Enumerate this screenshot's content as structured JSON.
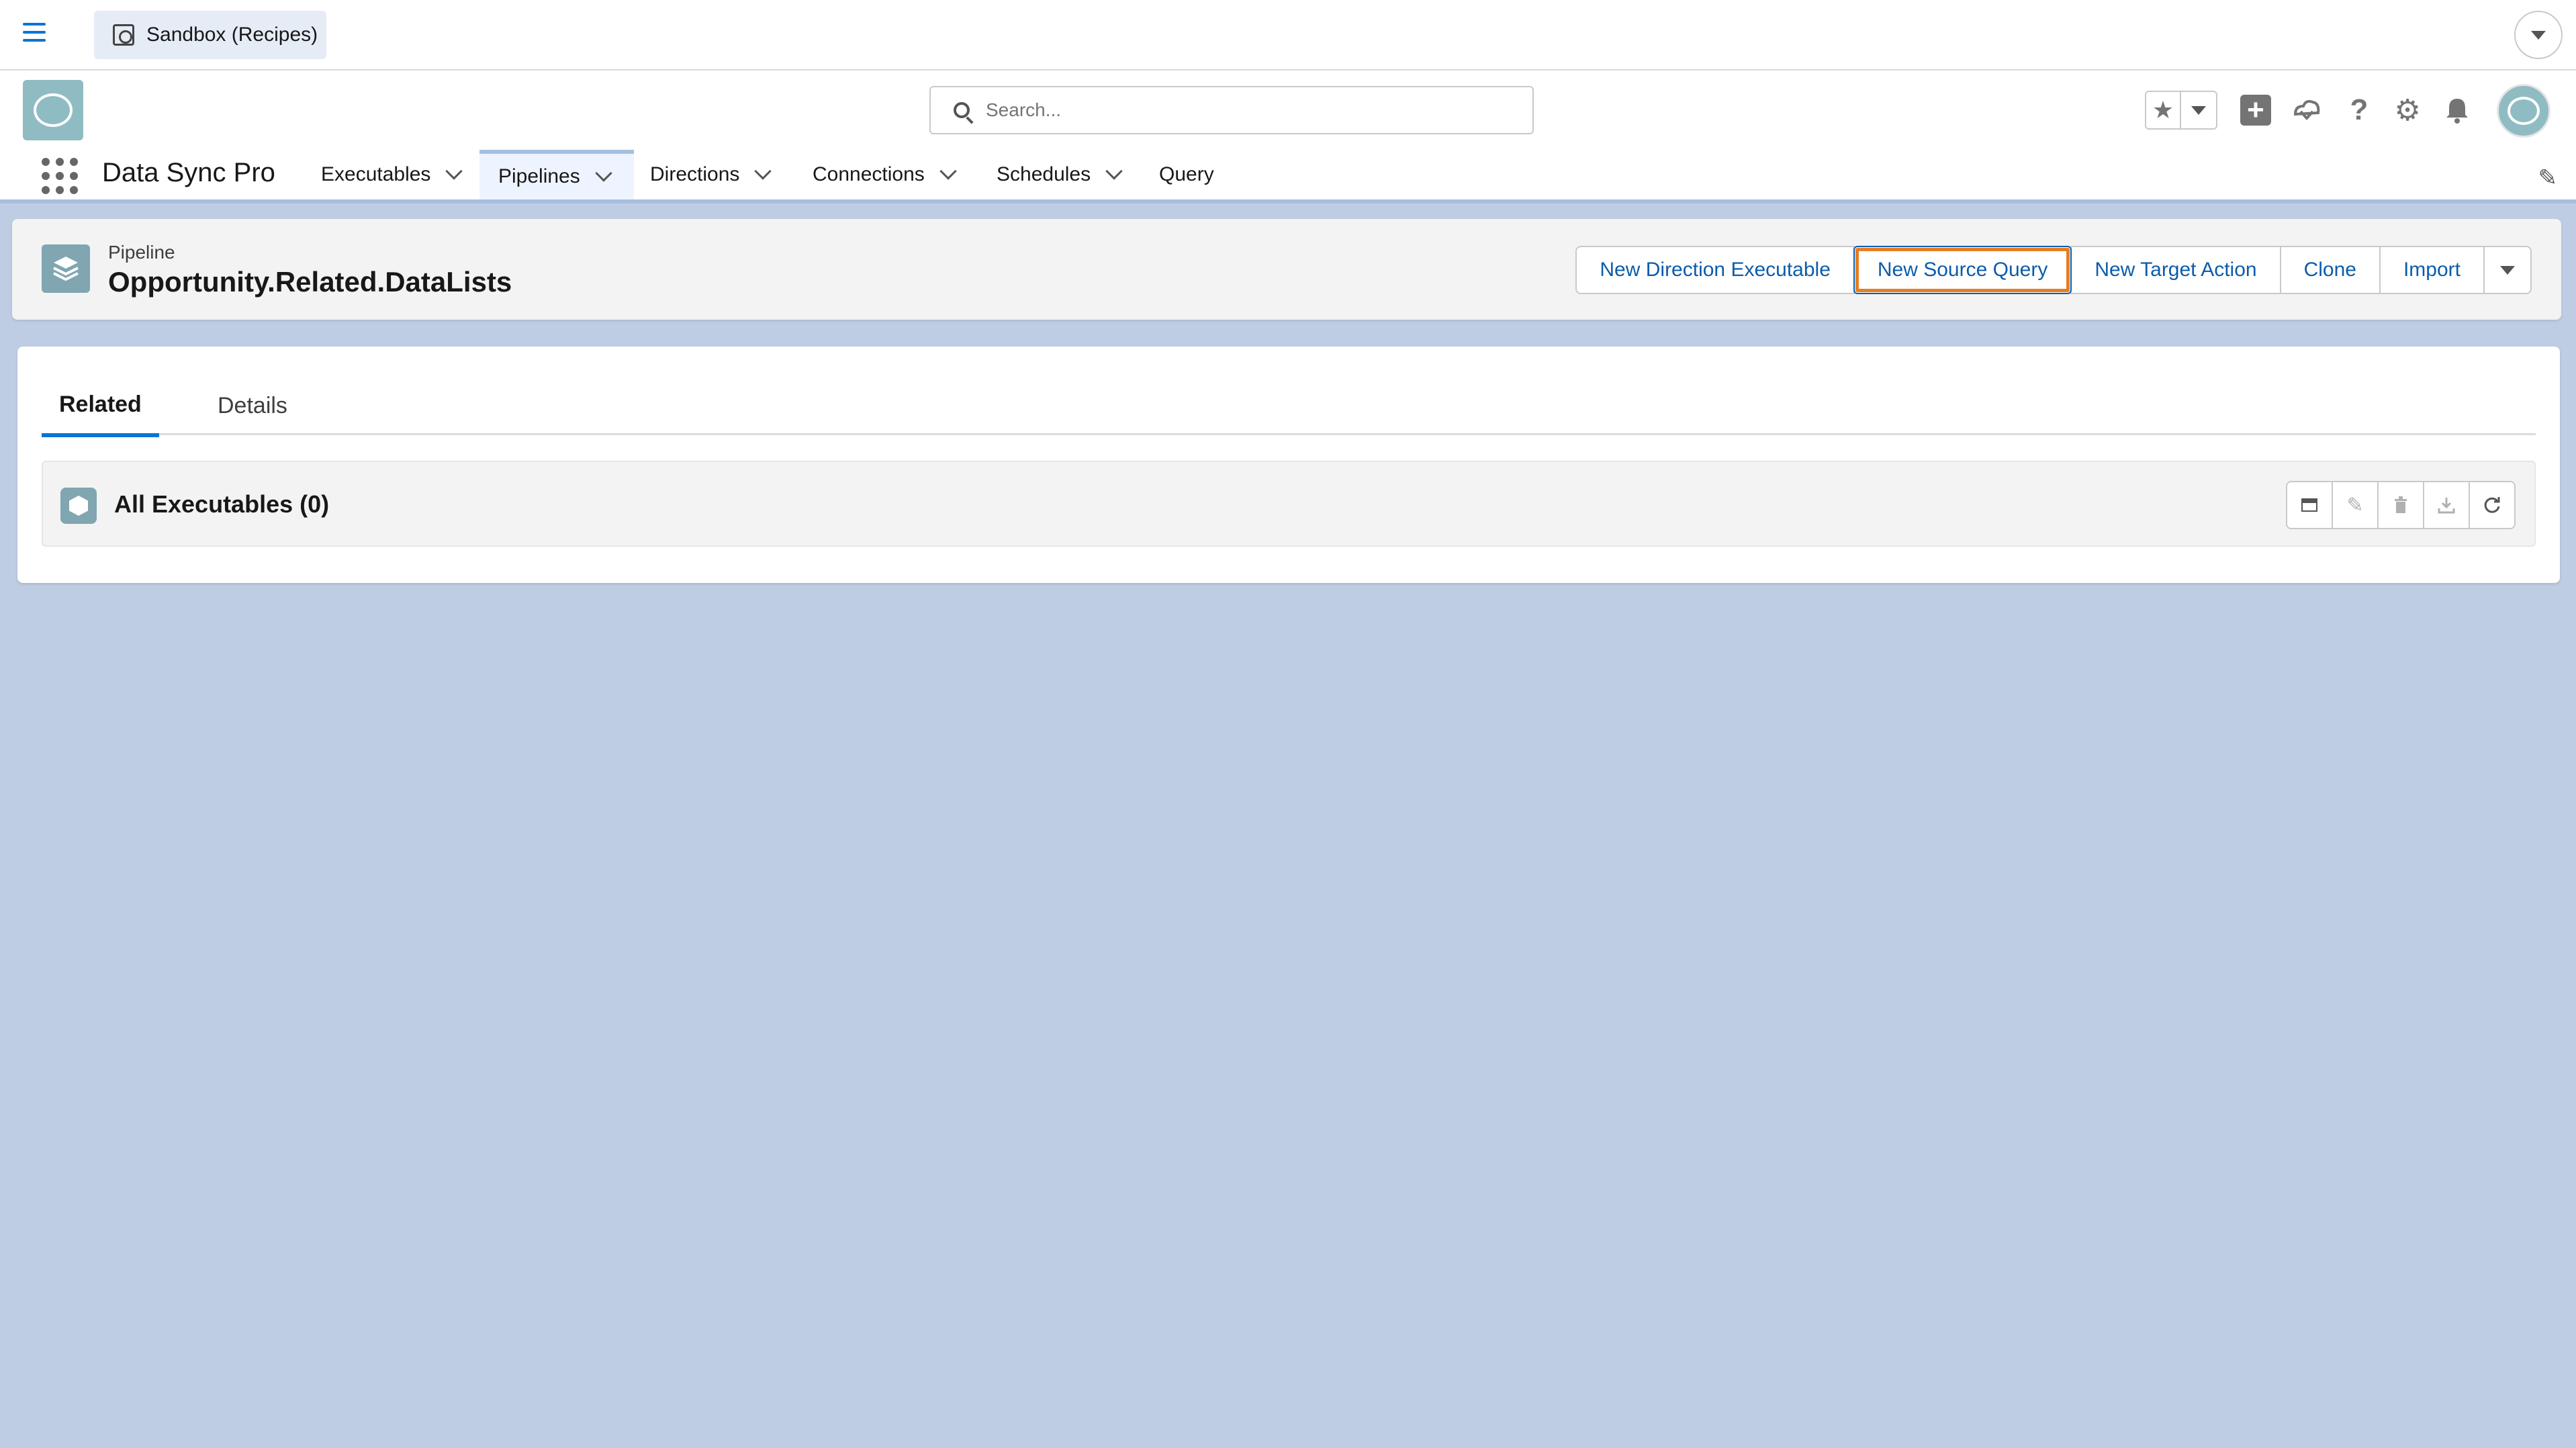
{
  "sandbox": {
    "label": "Sandbox (Recipes)"
  },
  "search": {
    "placeholder": "Search..."
  },
  "header_icons": {
    "favorites": "star-icon",
    "add": "plus-icon",
    "trailhead": "cloud-icon",
    "help": "help-icon",
    "setup": "gear-icon",
    "notifications": "bell-icon"
  },
  "app": {
    "name": "Data Sync Pro"
  },
  "nav": {
    "items": [
      {
        "label": "Executables",
        "has_menu": true
      },
      {
        "label": "Pipelines",
        "has_menu": true,
        "active": true
      },
      {
        "label": "Directions",
        "has_menu": true
      },
      {
        "label": "Connections",
        "has_menu": true
      },
      {
        "label": "Schedules",
        "has_menu": true
      },
      {
        "label": "Query",
        "has_menu": false
      }
    ]
  },
  "record": {
    "type": "Pipeline",
    "title": "Opportunity.Related.DataLists",
    "actions": [
      {
        "label": "New Direction Executable"
      },
      {
        "label": "New Source Query",
        "highlighted": true
      },
      {
        "label": "New Target Action"
      },
      {
        "label": "Clone"
      },
      {
        "label": "Import"
      }
    ]
  },
  "tabs": [
    {
      "label": "Related",
      "active": true
    },
    {
      "label": "Details",
      "active": false
    }
  ],
  "related_list": {
    "title": "All Executables (0)",
    "actions": [
      "table-icon",
      "edit-icon",
      "delete-icon",
      "download-icon",
      "refresh-icon"
    ]
  },
  "colors": {
    "brand": "#0176d3",
    "background": "#bfcde4",
    "highlight_outline": "#e67e22",
    "icon_teal": "#7fa6b1"
  }
}
